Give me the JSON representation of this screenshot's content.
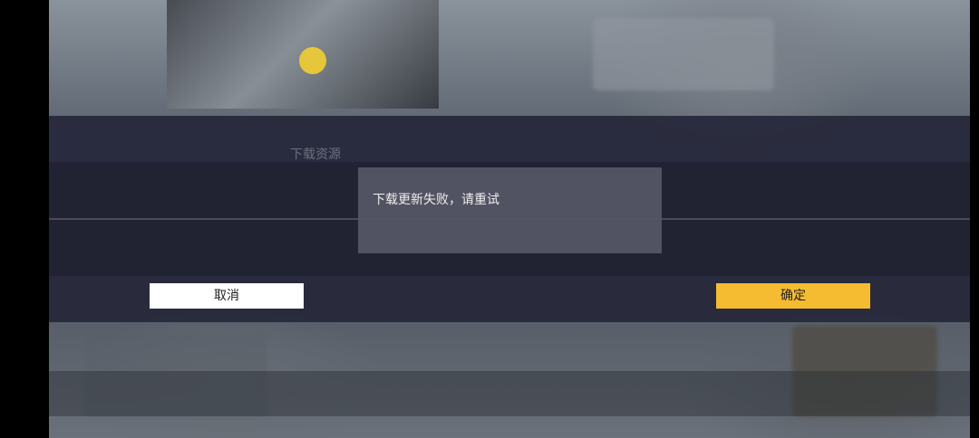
{
  "dialog": {
    "title": "下载资源",
    "cancel_label": "取消",
    "confirm_label": "确定"
  },
  "toast": {
    "message": "下载更新失败，请重试"
  },
  "colors": {
    "confirm_button": "#f5bc31",
    "cancel_button": "#ffffff",
    "dialog_band": "#26283a",
    "toast_bg": "#545564"
  }
}
